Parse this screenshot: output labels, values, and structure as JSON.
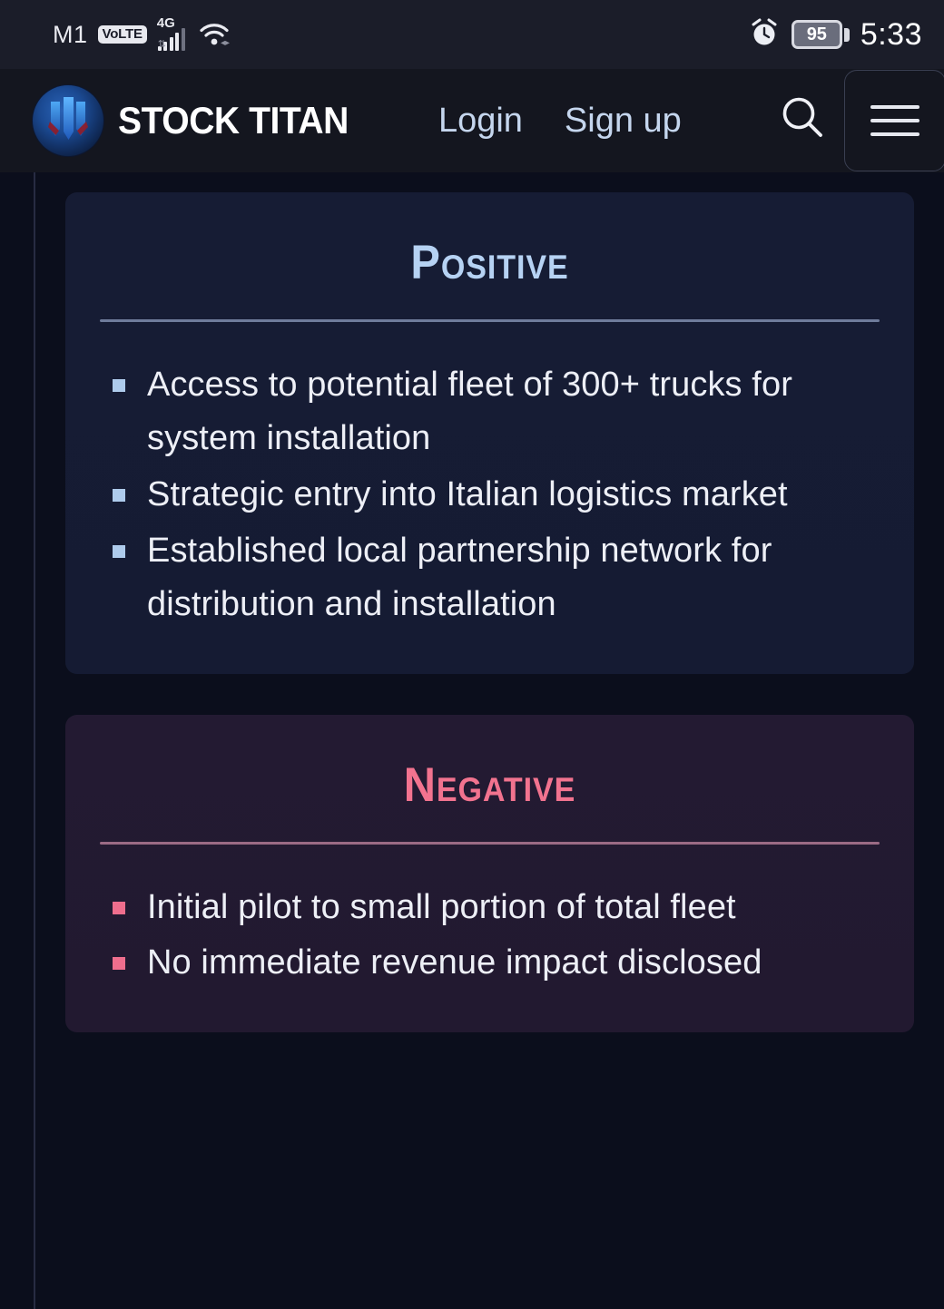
{
  "statusbar": {
    "carrier": "M1",
    "volte": "VoLTE",
    "network": "4G",
    "alarm_icon": "alarm-clock-icon",
    "wifi_icon": "wifi-icon",
    "signal_icon": "signal-bars-icon",
    "battery_level": "95",
    "time": "5:33"
  },
  "navbar": {
    "logo_icon": "stock-titan-logo-icon",
    "brand": "STOCK TITAN",
    "links": [
      {
        "label": "Login"
      },
      {
        "label": "Sign up"
      }
    ],
    "search_icon": "search-icon",
    "menu_icon": "hamburger-menu-icon"
  },
  "main": {
    "cards": [
      {
        "id": "positive",
        "title": "Positive",
        "accent": "#b6d2f3",
        "rule_color": "#6f7c9b",
        "bullet_color": "#aecbec",
        "background": "#161c34",
        "bullets": [
          "Access to potential fleet of 300+ trucks for system installation",
          "Strategic entry into Italian logistics market",
          "Established local partnership network for distribution and installation"
        ]
      },
      {
        "id": "negative",
        "title": "Negative",
        "accent": "#f2738f",
        "rule_color": "#9b6b85",
        "bullet_color": "#ef6e8d",
        "background": "#231a32",
        "bullets": [
          "Initial pilot to small portion of total fleet",
          "No immediate revenue impact disclosed"
        ]
      }
    ]
  }
}
